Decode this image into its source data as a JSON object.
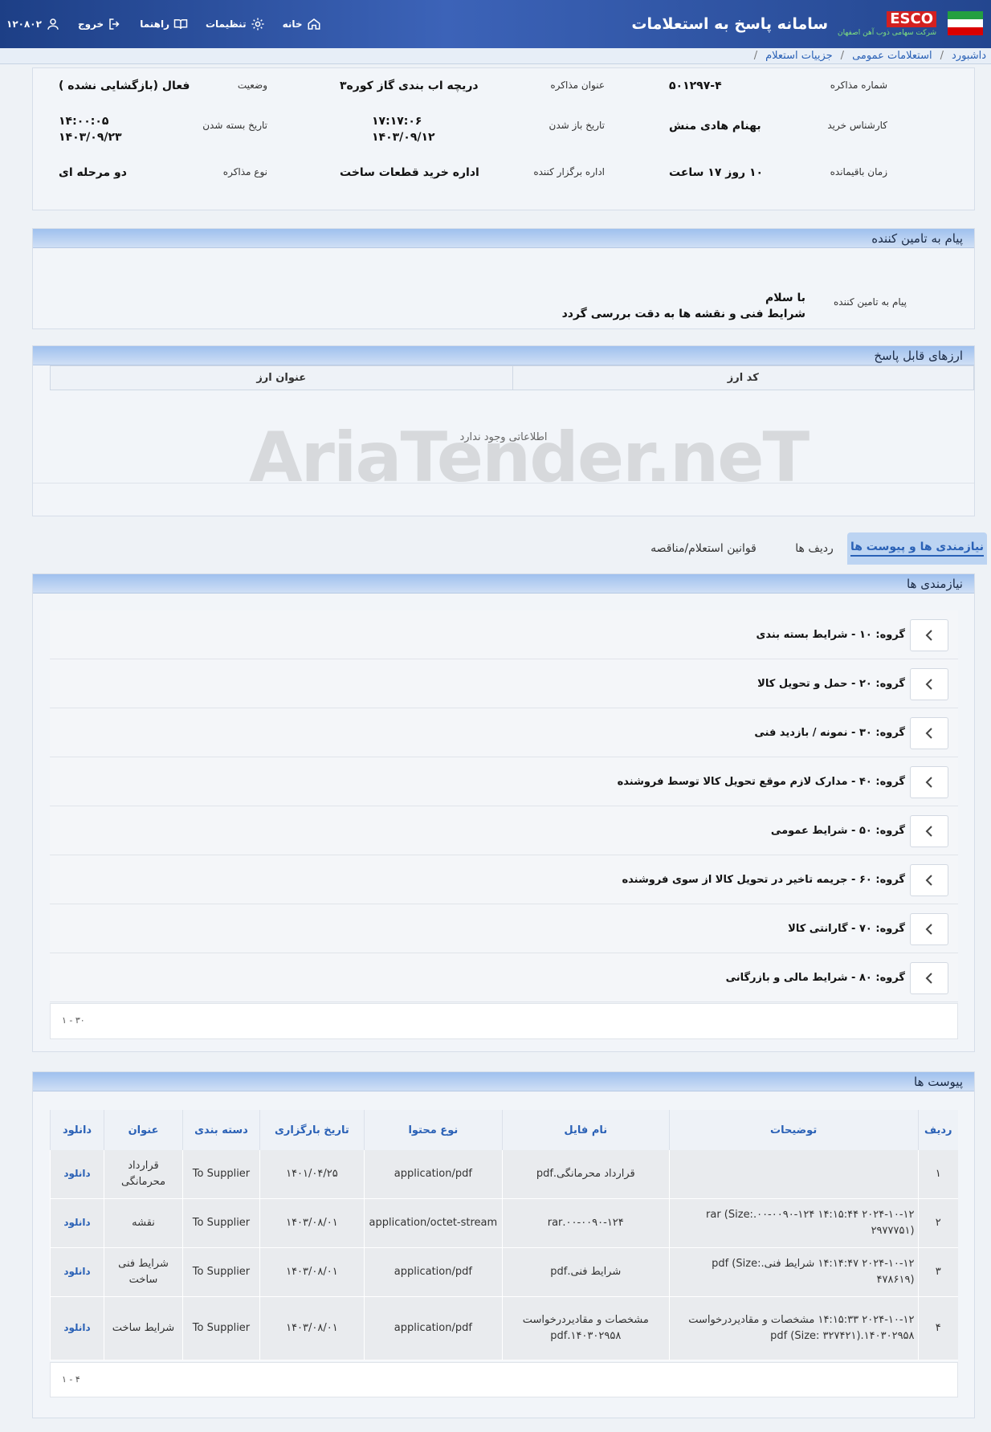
{
  "header": {
    "app_title": "سامانه پاسخ به استعلامات",
    "logo_text": "ESCO",
    "company_name": "شرکت سهامی ذوب آهن اصفهان",
    "actions": {
      "home": "خانه",
      "settings": "تنظیمات",
      "help": "راهنما",
      "logout": "خروج",
      "user_id": "۱۲۰۸۰۲"
    }
  },
  "breadcrumb": [
    "داشبورد",
    "استعلامات عمومی",
    "جزییات استعلام"
  ],
  "details": {
    "negotiation_number_label": "شماره مذاکره",
    "negotiation_number": "۵۰۱۲۹۷-۴",
    "negotiation_title_label": "عنوان مذاکره",
    "negotiation_title": "دریچه اب بندی گاز کوره۳",
    "status_label": "وضعیت",
    "status": "فعال (بازگشایی نشده )",
    "buyer_expert_label": "کارشناس خرید",
    "buyer_expert": "بهنام هادی منش",
    "open_date_label": "تاریخ باز شدن",
    "open_time": "۱۷:۱۷:۰۶",
    "open_date": "۱۴۰۳/۰۹/۱۲",
    "close_date_label": "تاریخ بسته شدن",
    "close_time": "۱۴:۰۰:۰۵",
    "close_date": "۱۴۰۳/۰۹/۲۳",
    "remaining_label": "زمان باقیمانده",
    "remaining": "۱۰ روز ۱۷ ساعت",
    "organizer_label": "اداره برگزار کننده",
    "organizer": "اداره خرید قطعات ساخت",
    "negotiation_type_label": "نوع مذاکره",
    "negotiation_type": "دو مرحله ای"
  },
  "supplier_message": {
    "section_title": "پیام به تامین کننده",
    "label": "پیام به تامین کننده",
    "line1": "با سلام",
    "line2": "شرایط فنی و نقشه ها به دقت بررسی گردد"
  },
  "currencies": {
    "section_title": "ارزهای قابل پاسخ",
    "col_code": "کد ارز",
    "col_title": "عنوان ارز",
    "empty": "اطلاعاتی وجود ندارد"
  },
  "watermark": "AriaTender.neT",
  "tabs": [
    "نیازمندی ها و پیوست ها",
    "ردیف ها",
    "قوانین استعلام/مناقصه"
  ],
  "requirements": {
    "section_title": "نیازمندی ها",
    "groups": [
      "گروه: ۱۰ - شرایط بسته بندی",
      "گروه: ۲۰ - حمل و تحویل کالا",
      "گروه: ۳۰ - نمونه / بازدید فنی",
      "گروه: ۴۰ - مدارک لازم موقع تحویل کالا توسط فروشنده",
      "گروه: ۵۰ - شرایط عمومی",
      "گروه: ۶۰ - جریمه تاخیر در تحویل کالا از سوی فروشنده",
      "گروه: ۷۰ - گارانتی کالا",
      "گروه: ۸۰ - شرایط مالی و بازرگانی"
    ],
    "pager": "۱ - ۳۰"
  },
  "attachments": {
    "section_title": "پیوست ها",
    "columns": [
      "ردیف",
      "توضیحات",
      "نام فایل",
      "نوع محتوا",
      "تاریخ بارگزاری",
      "دسته بندی",
      "عنوان",
      "دانلود"
    ],
    "rows": [
      {
        "idx": "۱",
        "desc": "",
        "file": "قرارداد محرمانگی.pdf",
        "type": "application/pdf",
        "date": "۱۴۰۱/۰۴/۲۵",
        "category": "To Supplier",
        "title": "قرارداد محرمانگی",
        "download": "دانلود"
      },
      {
        "idx": "۲",
        "desc": "۲۰۲۴-۱۰-۱۲ ۱۴:۱۵:۴۴ ۰۰-۰۰۹۰-۱۲۴.rar (Size: ۲۹۷۷۷۵۱)",
        "file": "۰۰-۰۰۹۰-۱۲۴.rar",
        "type": "application/octet-stream",
        "date": "۱۴۰۳/۰۸/۰۱",
        "category": "To Supplier",
        "title": "نقشه",
        "download": "دانلود"
      },
      {
        "idx": "۳",
        "desc": "۲۰۲۴-۱۰-۱۲ ۱۴:۱۴:۴۷ شرایط فنی.pdf (Size: ۴۷۸۶۱۹)",
        "file": "شرایط فنی.pdf",
        "type": "application/pdf",
        "date": "۱۴۰۳/۰۸/۰۱",
        "category": "To Supplier",
        "title": "شرایط فنی ساخت",
        "download": "دانلود"
      },
      {
        "idx": "۴",
        "desc": "۲۰۲۴-۱۰-۱۲ ۱۴:۱۵:۳۳ مشخصات و مقادیردرخواست ۱۴۰۳۰۲۹۵۸.pdf (Size: ۳۲۷۴۲۱)",
        "file": "مشخصات و مقادیردرخواست ۱۴۰۳۰۲۹۵۸.pdf",
        "type": "application/pdf",
        "date": "۱۴۰۳/۰۸/۰۱",
        "category": "To Supplier",
        "title": "شرایط ساخت",
        "download": "دانلود"
      }
    ],
    "pager": "۱ - ۴"
  }
}
